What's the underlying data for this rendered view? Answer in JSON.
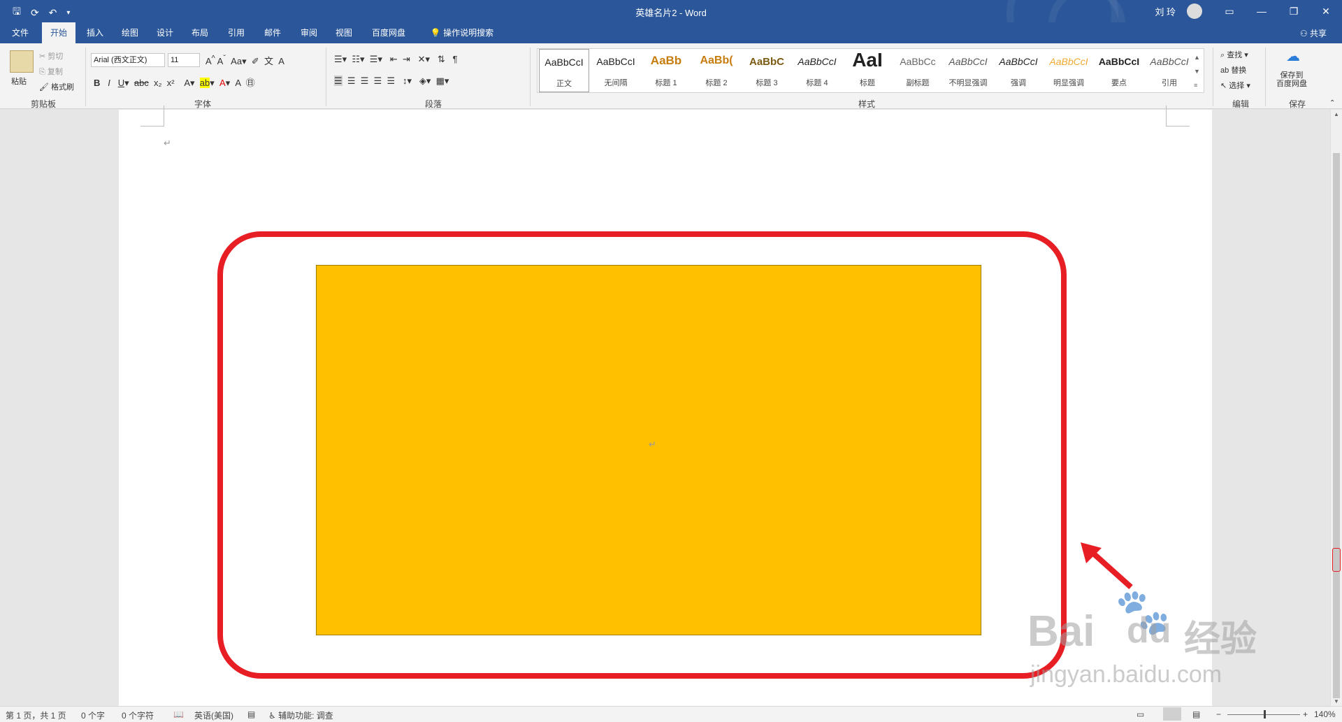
{
  "window": {
    "title": "英雄名片2  -  Word",
    "user": "刘 玲"
  },
  "tabs": [
    {
      "label": "文件"
    },
    {
      "label": "开始"
    },
    {
      "label": "插入"
    },
    {
      "label": "绘图"
    },
    {
      "label": "设计"
    },
    {
      "label": "布局"
    },
    {
      "label": "引用"
    },
    {
      "label": "邮件"
    },
    {
      "label": "审阅"
    },
    {
      "label": "视图"
    },
    {
      "label": "百度网盘"
    }
  ],
  "tell_me": "操作说明搜索",
  "share": "共享",
  "ribbon": {
    "clipboard": {
      "paste": "粘贴",
      "cut": "剪切",
      "copy": "复制",
      "format_painter": "格式刷",
      "label": "剪贴板"
    },
    "font": {
      "name": "Arial (西文正文)",
      "size": "11",
      "label": "字体"
    },
    "paragraph": {
      "label": "段落"
    },
    "styles": {
      "label": "样式",
      "items": [
        {
          "sample": "AaBbCcI",
          "name": "正文"
        },
        {
          "sample": "AaBbCcI",
          "name": "无间隔"
        },
        {
          "sample": "AaBb",
          "name": "标题 1"
        },
        {
          "sample": "AaBb(",
          "name": "标题 2"
        },
        {
          "sample": "AaBbC",
          "name": "标题 3"
        },
        {
          "sample": "AaBbCcI",
          "name": "标题 4"
        },
        {
          "sample": "AaI",
          "name": "标题"
        },
        {
          "sample": "AaBbCc",
          "name": "副标题"
        },
        {
          "sample": "AaBbCcI",
          "name": "不明显强调"
        },
        {
          "sample": "AaBbCcI",
          "name": "强调"
        },
        {
          "sample": "AaBbCcI",
          "name": "明显强调"
        },
        {
          "sample": "AaBbCcI",
          "name": "要点"
        },
        {
          "sample": "AaBbCcI",
          "name": "引用"
        }
      ]
    },
    "editing": {
      "find": "查找",
      "replace": "替换",
      "select": "选择",
      "label": "编辑"
    },
    "save": {
      "line1": "保存到",
      "line2": "百度网盘",
      "label": "保存"
    }
  },
  "status": {
    "page": "第 1 页，共 1 页",
    "words": "0 个字",
    "chars": "0 个字符",
    "language": "英语(美国)",
    "accessibility": "辅助功能: 调查",
    "zoom": "140%"
  },
  "watermark": {
    "main": "Bai",
    "du": "du",
    "cn": "经验",
    "url": "jingyan.baidu.com"
  },
  "colors": {
    "accent": "#2b579a",
    "shape_fill": "#ffc000",
    "annotation": "#e81e25"
  }
}
